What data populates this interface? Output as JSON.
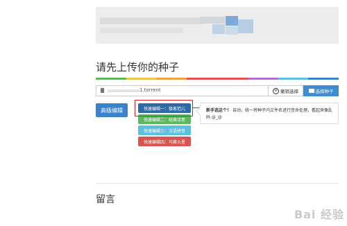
{
  "page_title": "请先上传你的种子",
  "rainbow_colors": [
    "#5cb85c",
    "#e9c84a",
    "#f0a040",
    "#e05050",
    "#e05050",
    "#b06bd0",
    "#5bc0de",
    "#3a83c8"
  ],
  "file_bar": {
    "file_name": "1.torrent",
    "clear_label": "撤销选择",
    "choose_label": "选择种子"
  },
  "advanced_button": "高级编辑",
  "quick_edit": [
    {
      "label": "快速编辑一：极客范儿"
    },
    {
      "label": "快速编辑二：经典诗意"
    },
    {
      "label": "快速编辑三：汉语拼音"
    },
    {
      "label": "快速编辑四：马赛火星"
    }
  ],
  "tip": {
    "title": "新手选这个！",
    "text": "自动，统一将种子内文件名进行签命处理，看起来像乱码 @_@"
  },
  "comments_title": "留言",
  "watermark": "Bai 经验"
}
